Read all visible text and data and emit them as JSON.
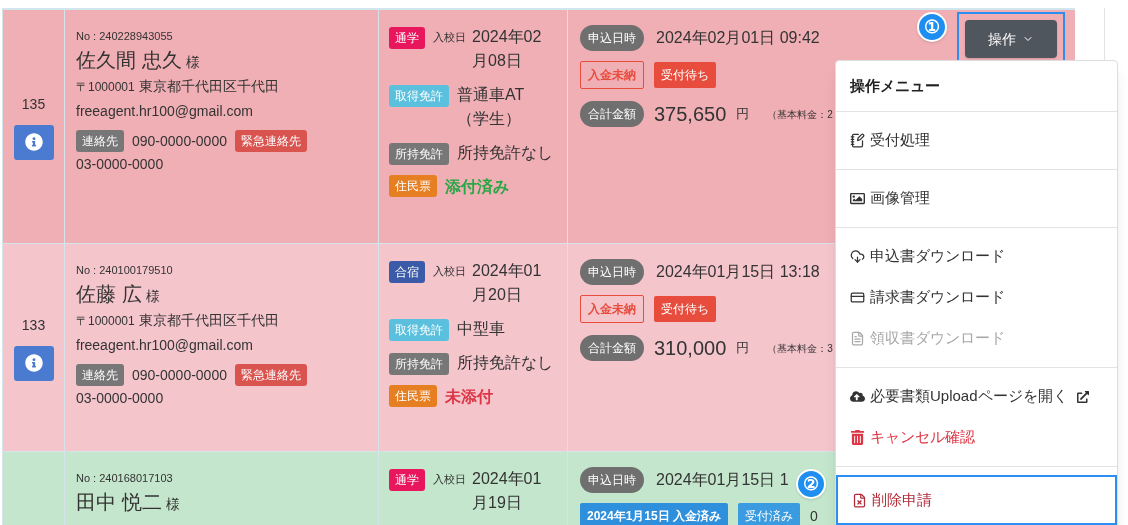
{
  "rows": [
    {
      "index": "135",
      "color": "#f0afb5",
      "customer": {
        "no": "No : 240228943055",
        "name": "佐久間 忠久",
        "honorific": "様",
        "postal": "〒1000001",
        "address": "東京都千代田区千代田",
        "email": "freeagent.hr100@gmail.com",
        "contact_label": "連絡先",
        "phone": "090-0000-0000",
        "emergency_label": "緊急連絡先",
        "emergency_phone": "03-0000-0000"
      },
      "course": {
        "type": {
          "label": "通学",
          "color": "#e8175d"
        },
        "entry_label": "入校日",
        "entry_date": "2024年02月08日",
        "license_label": "取得免許",
        "license": "普通車AT（学生）",
        "held_label": "所持免許",
        "held": "所持免許なし",
        "resident_label": "住民票",
        "resident_status": "添付済み",
        "attached": true
      },
      "application": {
        "date_label": "申込日時",
        "date": "2024年02月01日 09:42",
        "statuses": [
          {
            "label": "入金未納",
            "kind": "unpaid"
          },
          {
            "label": "受付待ち",
            "kind": "waiting"
          }
        ],
        "total_label": "合計金額",
        "amount": "375,650",
        "unit": "円",
        "breakdown": "（基本料金：2"
      }
    },
    {
      "index": "133",
      "color": "#f5c5cc",
      "customer": {
        "no": "No : 240100179510",
        "name": "佐藤 広",
        "honorific": "様",
        "postal": "〒1000001",
        "address": "東京都千代田区千代田",
        "email": "freeagent.hr100@gmail.com",
        "contact_label": "連絡先",
        "phone": "090-0000-0000",
        "emergency_label": "緊急連絡先",
        "emergency_phone": "03-0000-0000"
      },
      "course": {
        "type": {
          "label": "合宿",
          "color": "#3b5aa8"
        },
        "entry_label": "入校日",
        "entry_date": "2024年01月20日",
        "license_label": "取得免許",
        "license": "中型車",
        "held_label": "所持免許",
        "held": "所持免許なし",
        "resident_label": "住民票",
        "resident_status": "未添付",
        "attached": false
      },
      "application": {
        "date_label": "申込日時",
        "date": "2024年01月15日 13:18",
        "statuses": [
          {
            "label": "入金未納",
            "kind": "unpaid"
          },
          {
            "label": "受付待ち",
            "kind": "waiting"
          }
        ],
        "total_label": "合計金額",
        "amount": "310,000",
        "unit": "円",
        "breakdown": "（基本料金：3"
      }
    },
    {
      "color": "#c4e6cc",
      "customer": {
        "no": "No : 240168017103",
        "name": "田中 悦二",
        "honorific": "様"
      },
      "course": {
        "type": {
          "label": "通学",
          "color": "#e8175d"
        },
        "entry_label": "入校日",
        "entry_date": "2024年01月19日"
      },
      "application": {
        "date_label": "申込日時",
        "date": "2024年01月15日 1",
        "statuses": [
          {
            "label": "2024年1月15日 入金済み",
            "kind": "paid"
          },
          {
            "label": "受付済み",
            "kind": "accepted"
          }
        ],
        "extra": "0"
      }
    }
  ],
  "ops_button": {
    "label": "操作",
    "callout": "①"
  },
  "menu": {
    "title": "操作メニュー",
    "groups": [
      [
        {
          "label": "受付処理",
          "kind": "reception",
          "disabled": false,
          "color": "#333333"
        }
      ],
      [
        {
          "label": "画像管理",
          "kind": "images",
          "disabled": false,
          "color": "#333333"
        }
      ],
      [
        {
          "label": "申込書ダウンロード",
          "kind": "download",
          "disabled": false,
          "color": "#333333"
        },
        {
          "label": "請求書ダウンロード",
          "kind": "invoice",
          "disabled": false,
          "color": "#333333"
        },
        {
          "label": "領収書ダウンロード",
          "kind": "receipt",
          "disabled": true
        }
      ],
      [
        {
          "label": "必要書類Uploadページを開く",
          "kind": "upload",
          "external": true,
          "disabled": false,
          "color": "#333333"
        },
        {
          "label": "キャンセル確認",
          "kind": "cancel",
          "disabled": false,
          "color": "#dc3545"
        }
      ],
      [
        {
          "label": "削除申請",
          "kind": "delete",
          "disabled": false,
          "color": "#b02a37",
          "callout": "②"
        }
      ]
    ]
  }
}
